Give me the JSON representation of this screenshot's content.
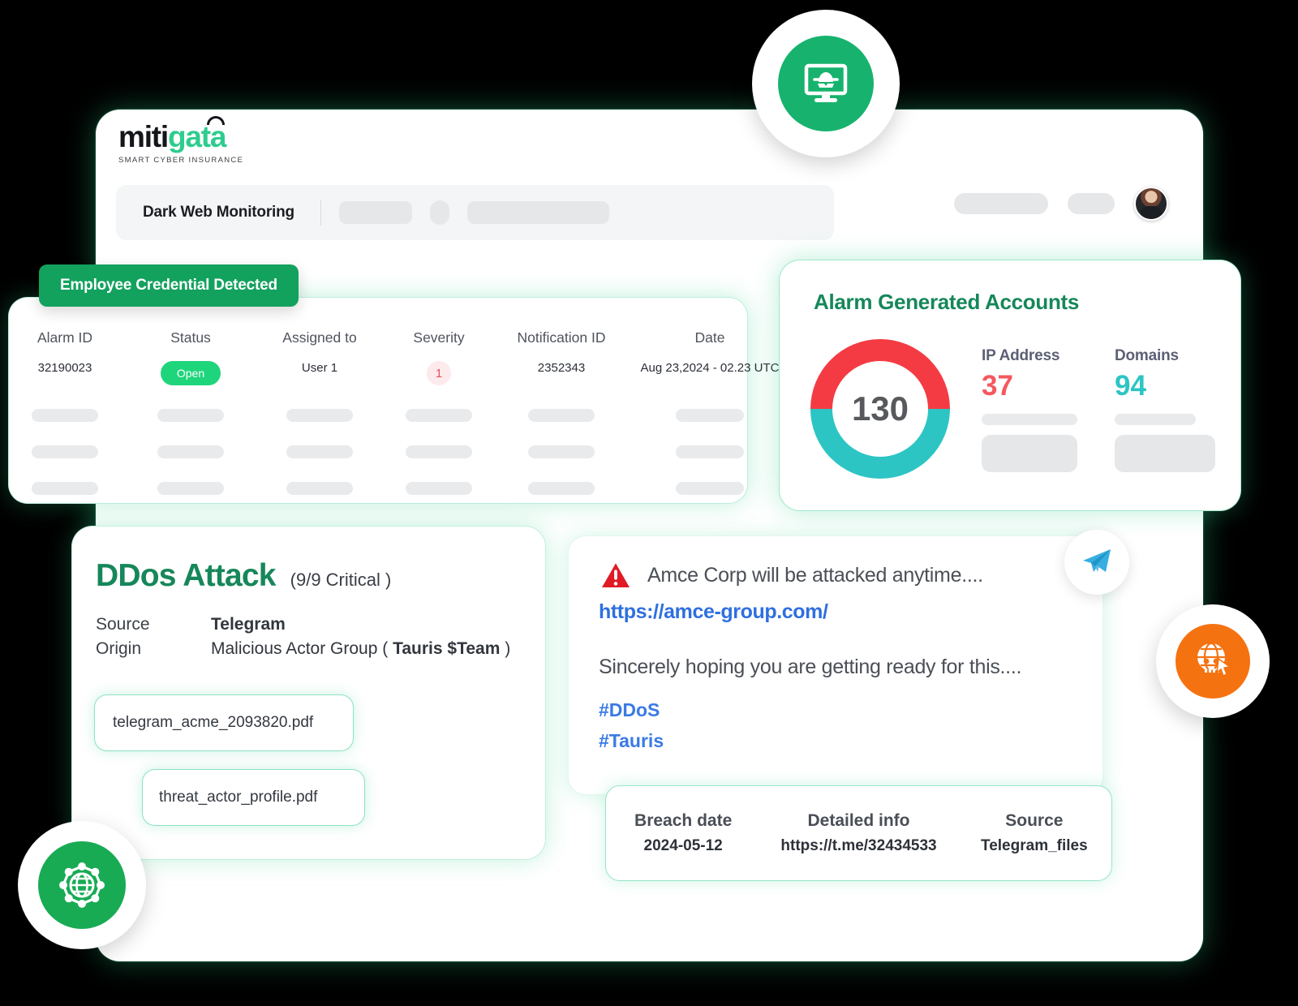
{
  "brand": {
    "name_part1": "miti",
    "name_part2": "gata",
    "tagline": "SMART CYBER INSURANCE",
    "accent_green": "#2ecc8f"
  },
  "header": {
    "section_title": "Dark Web Monitoring",
    "monitor_spy_icon": "monitor-spy-icon"
  },
  "alarm_table": {
    "badge_label": "Employee Credential Detected",
    "columns": [
      "Alarm ID",
      "Status",
      "Assigned to",
      "Severity",
      "Notification ID",
      "Date"
    ],
    "row": {
      "alarm_id": "32190023",
      "status": "Open",
      "assigned_to": "User 1",
      "severity": "1",
      "notification_id": "2352343",
      "date": "Aug 23,2024 - 02.23 UTC"
    },
    "skeleton_rows": 3
  },
  "alarm_accounts": {
    "title": "Alarm Generated Accounts",
    "total": "130",
    "ip_address_label": "IP Address",
    "ip_address_value": "37",
    "domains_label": "Domains",
    "domains_value": "94",
    "colors": {
      "red": "#f43b43",
      "teal": "#2cc5c4",
      "title": "#16875a"
    }
  },
  "ddos": {
    "title": "DDos Attack",
    "severity": "(9/9 Critical )",
    "source_label": "Source",
    "source_value": "Telegram",
    "origin_label": "Origin",
    "origin_value_prefix": "Malicious Actor Group ( ",
    "origin_value_actor": "Tauris $Team",
    "origin_value_suffix": " )",
    "files": [
      "telegram_acme_2093820.pdf",
      "threat_actor_profile.pdf"
    ]
  },
  "message": {
    "warning_icon": "warning-triangle-icon",
    "line1": "Amce Corp will be attacked anytime....",
    "link": "https://amce-group.com/",
    "line2": "Sincerely hoping you are getting ready for this....",
    "hashtag1": "#DDoS",
    "hashtag2": "#Tauris",
    "telegram_icon": "telegram-send-icon"
  },
  "breach": {
    "columns": [
      "Breach date",
      "Detailed info",
      "Source"
    ],
    "values": [
      "2024-05-12",
      "https://t.me/32434533",
      "Telegram_files"
    ]
  },
  "chart_data": {
    "type": "pie",
    "title": "Alarm Generated Accounts",
    "categories": [
      "IP Address",
      "Domains"
    ],
    "values": [
      37,
      94
    ],
    "total": 130,
    "colors": [
      "#f43b43",
      "#2cc5c4"
    ],
    "legend": "right",
    "center_label": "130",
    "note": "Donut rendered as two equal visual halves: red (top) = IP Address, teal (bottom) = Domains"
  },
  "floating_icons": {
    "monitor_spy": "monitor-spy-icon",
    "network_globe": "network-globe-icon",
    "globe_attack": "globe-cursor-attack-icon",
    "telegram": "telegram-icon"
  }
}
